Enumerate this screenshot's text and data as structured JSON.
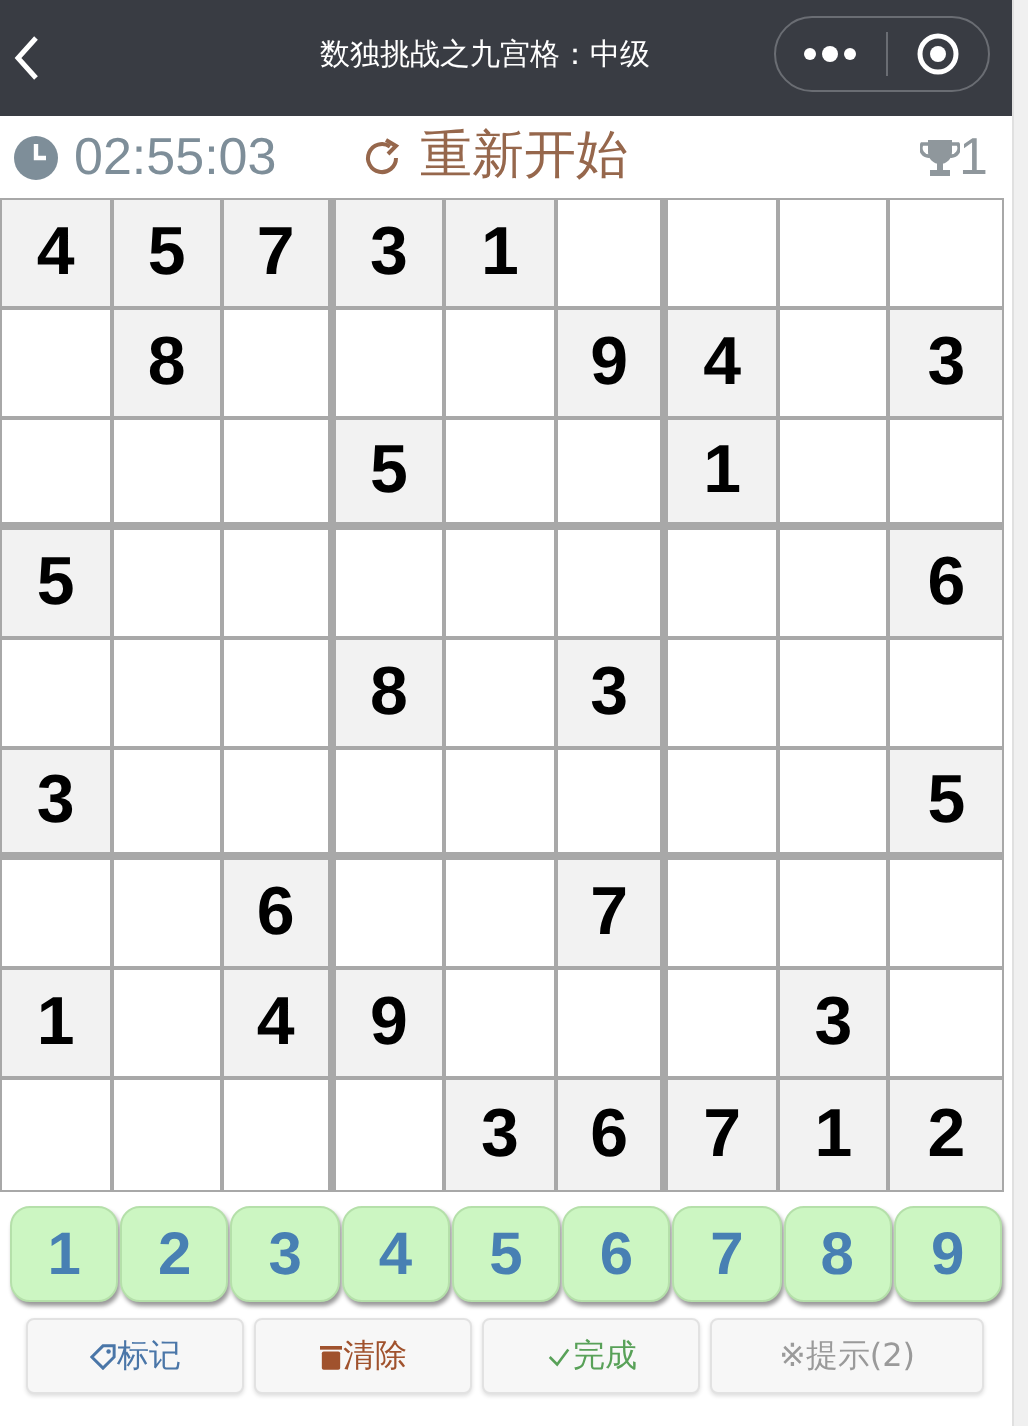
{
  "nav": {
    "title": "数独挑战之九宫格：中级"
  },
  "status": {
    "timer": "02:55:03",
    "restart": "重新开始",
    "trophies": "1"
  },
  "board": {
    "rows": [
      [
        "4",
        "5",
        "7",
        "3",
        "1",
        null,
        null,
        null,
        null
      ],
      [
        null,
        "8",
        null,
        null,
        null,
        "9",
        "4",
        null,
        "3"
      ],
      [
        null,
        null,
        null,
        "5",
        null,
        null,
        "1",
        null,
        null
      ],
      [
        "5",
        null,
        null,
        null,
        null,
        null,
        null,
        null,
        "6"
      ],
      [
        null,
        null,
        null,
        "8",
        null,
        "3",
        null,
        null,
        null
      ],
      [
        "3",
        null,
        null,
        null,
        null,
        null,
        null,
        null,
        "5"
      ],
      [
        null,
        null,
        "6",
        null,
        null,
        "7",
        null,
        null,
        null
      ],
      [
        "1",
        null,
        "4",
        "9",
        null,
        null,
        null,
        "3",
        null
      ],
      [
        null,
        null,
        null,
        null,
        "3",
        "6",
        "7",
        "1",
        "2"
      ]
    ]
  },
  "number_pad": [
    "1",
    "2",
    "3",
    "4",
    "5",
    "6",
    "7",
    "8",
    "9"
  ],
  "actions": [
    {
      "kind": "mark",
      "label": "标记"
    },
    {
      "kind": "clear",
      "label": "清除"
    },
    {
      "kind": "done",
      "label": "完成"
    },
    {
      "kind": "hint",
      "label": "※提示(2)"
    }
  ]
}
